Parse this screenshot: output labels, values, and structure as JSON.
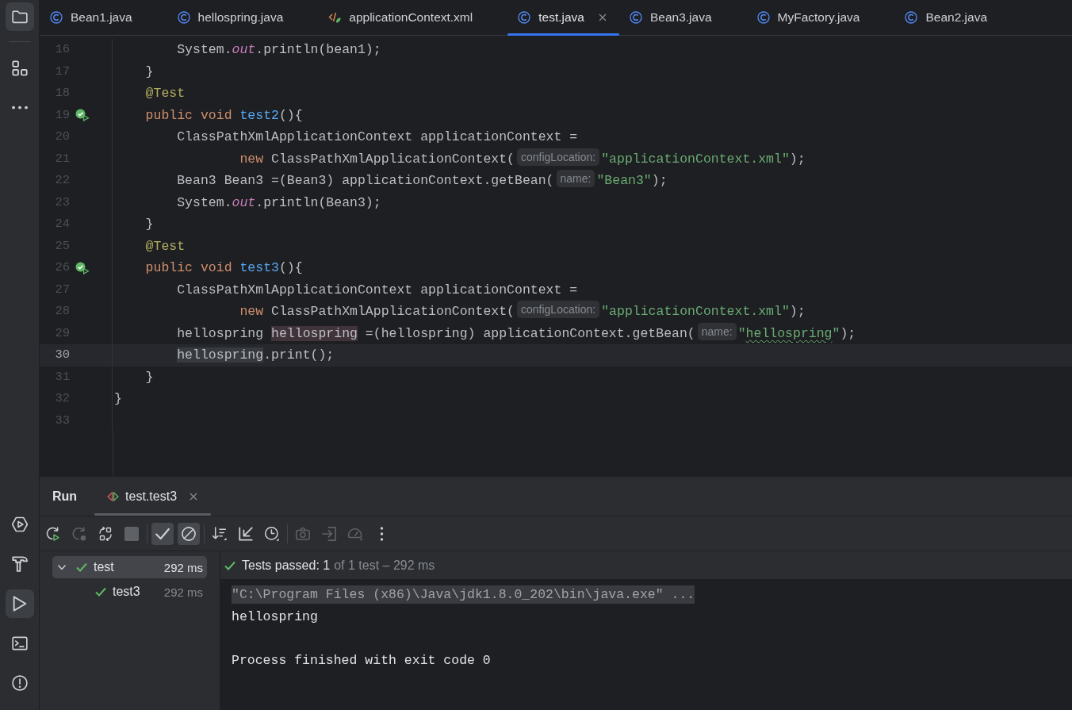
{
  "sidebar": {
    "top": [
      {
        "kind": "project",
        "selected": true
      },
      {
        "kind": "structure",
        "selected": false
      },
      {
        "kind": "more",
        "selected": false
      }
    ],
    "bottom": [
      {
        "kind": "services",
        "selected": false
      },
      {
        "kind": "build",
        "selected": false
      },
      {
        "kind": "run",
        "selected": true
      },
      {
        "kind": "terminal",
        "selected": false
      },
      {
        "kind": "problems",
        "selected": false
      }
    ]
  },
  "tabs": [
    {
      "label": "Bean1.java",
      "kind": "class",
      "selected": false
    },
    {
      "label": "hellospring.java",
      "kind": "class",
      "selected": false
    },
    {
      "label": "applicationContext.xml",
      "kind": "xml",
      "selected": false
    },
    {
      "label": "test.java",
      "kind": "class",
      "selected": true
    },
    {
      "label": "Bean3.java",
      "kind": "class",
      "selected": false
    },
    {
      "label": "MyFactory.java",
      "kind": "class",
      "selected": false
    },
    {
      "label": "Bean2.java",
      "kind": "class",
      "selected": false
    }
  ],
  "editor": {
    "lines": [
      {
        "number": "16",
        "current": false,
        "run_marker": false,
        "tokens": [
          {
            "text": "        System.",
            "kind": "plain"
          },
          {
            "text": "out",
            "kind": "field"
          },
          {
            "text": ".println(bean1);",
            "kind": "plain"
          }
        ]
      },
      {
        "number": "17",
        "current": false,
        "run_marker": false,
        "tokens": [
          {
            "text": "    }",
            "kind": "plain"
          }
        ]
      },
      {
        "number": "18",
        "current": false,
        "run_marker": false,
        "tokens": [
          {
            "text": "    @Test",
            "kind": "annotation"
          }
        ]
      },
      {
        "number": "19",
        "current": false,
        "run_marker": true,
        "tokens": [
          {
            "text": "    public void ",
            "kind": "keyword"
          },
          {
            "text": "test2",
            "kind": "decl"
          },
          {
            "text": "(){",
            "kind": "plain"
          }
        ]
      },
      {
        "number": "20",
        "current": false,
        "run_marker": false,
        "tokens": [
          {
            "text": "        ClassPathXmlApplicationContext applicationContext =",
            "kind": "plain"
          }
        ]
      },
      {
        "number": "21",
        "current": false,
        "run_marker": false,
        "tokens": [
          {
            "text": "                new ",
            "kind": "keyword"
          },
          {
            "text": "ClassPathXmlApplicationContext(",
            "kind": "plain"
          },
          {
            "text": "configLocation:",
            "kind": "hint"
          },
          {
            "text": "\"applicationContext.xml\"",
            "kind": "string"
          },
          {
            "text": ");",
            "kind": "plain"
          }
        ]
      },
      {
        "number": "22",
        "current": false,
        "run_marker": false,
        "tokens": [
          {
            "text": "        Bean3 Bean3 =(Bean3) applicationContext.getBean(",
            "kind": "plain"
          },
          {
            "text": "name:",
            "kind": "hint"
          },
          {
            "text": "\"Bean3\"",
            "kind": "string"
          },
          {
            "text": ");",
            "kind": "plain"
          }
        ]
      },
      {
        "number": "23",
        "current": false,
        "run_marker": false,
        "tokens": [
          {
            "text": "        System.",
            "kind": "plain"
          },
          {
            "text": "out",
            "kind": "field"
          },
          {
            "text": ".println(Bean3);",
            "kind": "plain"
          }
        ]
      },
      {
        "number": "24",
        "current": false,
        "run_marker": false,
        "tokens": [
          {
            "text": "    }",
            "kind": "plain"
          }
        ]
      },
      {
        "number": "25",
        "current": false,
        "run_marker": false,
        "tokens": [
          {
            "text": "    @Test",
            "kind": "annotation"
          }
        ]
      },
      {
        "number": "26",
        "current": false,
        "run_marker": true,
        "tokens": [
          {
            "text": "    public void ",
            "kind": "keyword"
          },
          {
            "text": "test3",
            "kind": "decl"
          },
          {
            "text": "(){",
            "kind": "plain"
          }
        ]
      },
      {
        "number": "27",
        "current": false,
        "run_marker": false,
        "tokens": [
          {
            "text": "        ClassPathXmlApplicationContext applicationContext =",
            "kind": "plain"
          }
        ]
      },
      {
        "number": "28",
        "current": false,
        "run_marker": false,
        "tokens": [
          {
            "text": "                new ",
            "kind": "keyword"
          },
          {
            "text": "ClassPathXmlApplicationContext(",
            "kind": "plain"
          },
          {
            "text": "configLocation:",
            "kind": "hint"
          },
          {
            "text": "\"applicationContext.xml\"",
            "kind": "string"
          },
          {
            "text": ");",
            "kind": "plain"
          }
        ]
      },
      {
        "number": "29",
        "current": false,
        "run_marker": false,
        "tokens": [
          {
            "text": "        hellospring ",
            "kind": "plain"
          },
          {
            "text": "hellospring",
            "kind": "usage-write"
          },
          {
            "text": " =(hellospring) applicationContext.getBean(",
            "kind": "plain"
          },
          {
            "text": "name:",
            "kind": "hint"
          },
          {
            "text": "\"",
            "kind": "string"
          },
          {
            "text": "hellospring",
            "kind": "typo"
          },
          {
            "text": "\"",
            "kind": "string"
          },
          {
            "text": ");",
            "kind": "plain"
          }
        ]
      },
      {
        "number": "30",
        "current": true,
        "run_marker": false,
        "tokens": [
          {
            "text": "        hellospring",
            "kind": "usage-read"
          },
          {
            "text": ".print();",
            "kind": "plain"
          }
        ]
      },
      {
        "number": "31",
        "current": false,
        "run_marker": false,
        "tokens": [
          {
            "text": "    }",
            "kind": "plain"
          }
        ]
      },
      {
        "number": "32",
        "current": false,
        "run_marker": false,
        "tokens": [
          {
            "text": "}",
            "kind": "plain"
          }
        ]
      },
      {
        "number": "33",
        "current": false,
        "run_marker": false
      }
    ]
  },
  "run_panel": {
    "title": "Run",
    "tabs": [
      {
        "label": "test.test3",
        "selected": true
      }
    ],
    "toolbar": [
      {
        "items": [
          {
            "kind": "rerun",
            "selected": false,
            "disabled": false
          },
          {
            "kind": "rerun-failed",
            "selected": false,
            "disabled": true
          },
          {
            "kind": "auto-rerun",
            "selected": false,
            "disabled": false
          },
          {
            "kind": "stop",
            "selected": false,
            "disabled": true
          }
        ]
      },
      {
        "items": [
          {
            "kind": "show-passed",
            "selected": true,
            "disabled": false
          },
          {
            "kind": "show-ignored",
            "selected": true,
            "disabled": false
          }
        ]
      },
      {
        "items": [
          {
            "kind": "sort",
            "selected": false,
            "disabled": false
          },
          {
            "kind": "collapse",
            "selected": false,
            "disabled": false
          },
          {
            "kind": "history",
            "selected": false,
            "disabled": false
          }
        ]
      },
      {
        "items": [
          {
            "kind": "snapshot",
            "selected": false,
            "disabled": true
          },
          {
            "kind": "import",
            "selected": false,
            "disabled": true
          },
          {
            "kind": "profiler",
            "selected": false,
            "disabled": true
          },
          {
            "kind": "more",
            "selected": false,
            "disabled": false
          }
        ]
      }
    ],
    "tree": [
      {
        "label": "test",
        "time": "292 ms",
        "passed": true,
        "expanded": true,
        "selected": true,
        "children": [
          {
            "label": "test3",
            "time": "292 ms",
            "passed": true,
            "selected": false
          }
        ]
      }
    ],
    "summary": {
      "passed": true,
      "label": "Tests passed: 1",
      "detail": "of 1 test – 292 ms"
    },
    "console": [
      {
        "text": "\"C:\\Program Files (x86)\\Java\\jdk1.8.0_202\\bin\\java.exe\" ...",
        "kind": "command"
      },
      {
        "text": "hellospring",
        "kind": "output"
      },
      {
        "text": "Process finished with exit code 0",
        "kind": "exit"
      }
    ]
  }
}
